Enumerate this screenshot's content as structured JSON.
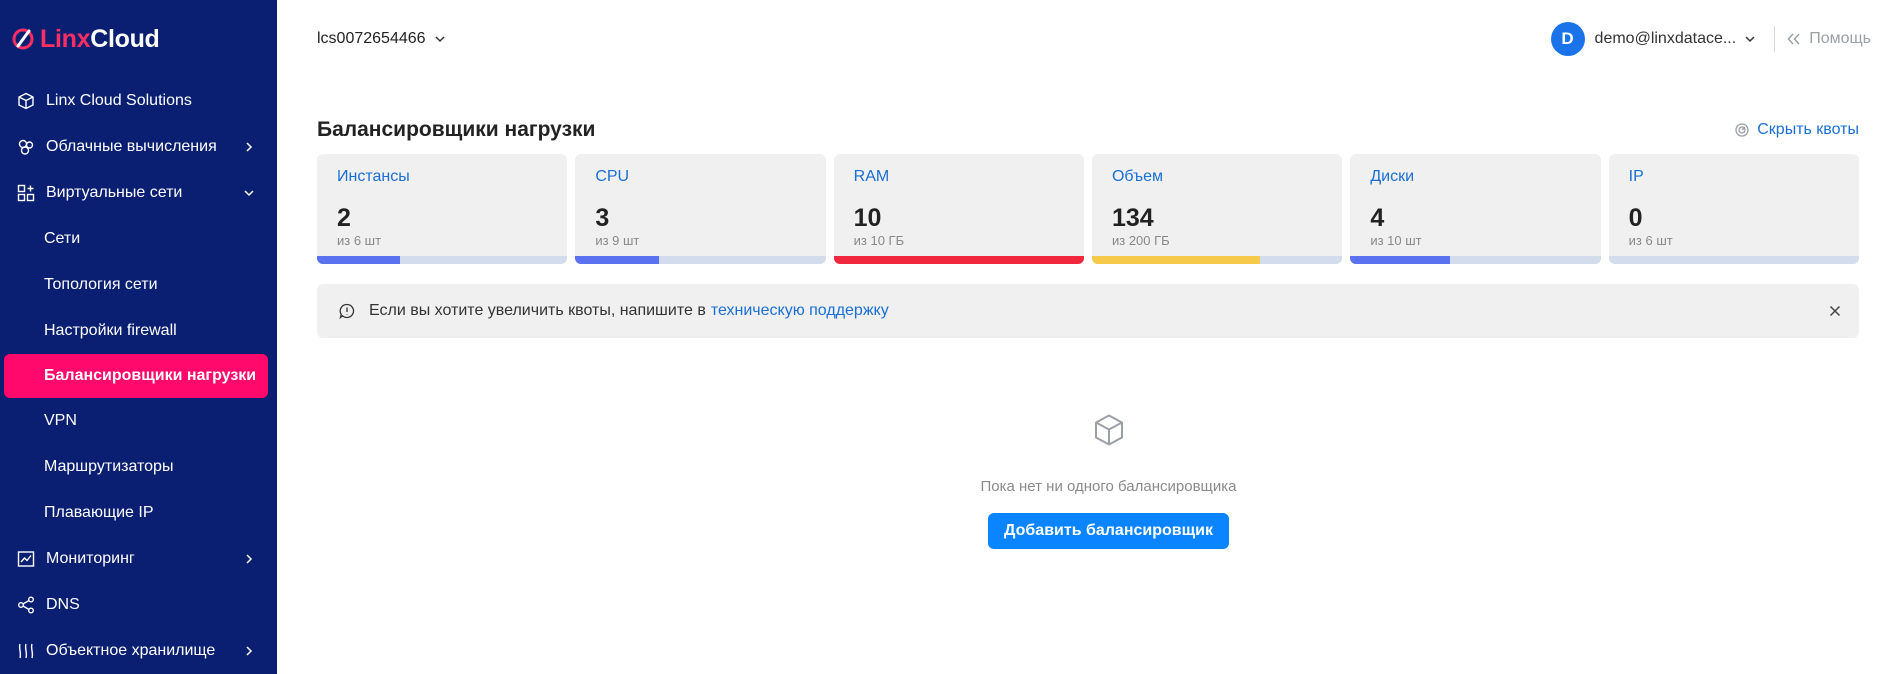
{
  "brand": {
    "part1": "Linx",
    "part2": "Cloud",
    "accent": "#ff2e63"
  },
  "sidebar": {
    "items": [
      {
        "label": "Linx Cloud Solutions",
        "icon": "cube-icon"
      },
      {
        "label": "Облачные вычисления",
        "icon": "cloud-compute-icon",
        "chevron": "right"
      },
      {
        "label": "Виртуальные сети",
        "icon": "network-icon",
        "chevron": "down"
      }
    ],
    "sub_items": [
      "Сети",
      "Топология сети",
      "Настройки firewall",
      "Балансировщики нагрузки",
      "VPN",
      "Маршрутизаторы",
      "Плавающие IP"
    ],
    "active_sub": "Балансировщики нагрузки",
    "bottom_items": [
      {
        "label": "Мониторинг",
        "icon": "chart-icon",
        "chevron": "right"
      },
      {
        "label": "DNS",
        "icon": "share-icon"
      },
      {
        "label": "Объектное хранилище",
        "icon": "storage-icon",
        "chevron": "right"
      }
    ]
  },
  "topbar": {
    "project": "lcs0072654466",
    "avatar_letter": "D",
    "user": "demo@linxdatace...",
    "help": "Помощь"
  },
  "page": {
    "title": "Балансировщики нагрузки",
    "hide_quotas": "Скрыть квоты"
  },
  "quotas": [
    {
      "title": "Инстансы",
      "value": "2",
      "sub": "из 6 шт",
      "fill": 0.333,
      "color": "#5a72f0"
    },
    {
      "title": "CPU",
      "value": "3",
      "sub": "из 9 шт",
      "fill": 0.333,
      "color": "#5a72f0"
    },
    {
      "title": "RAM",
      "value": "10",
      "sub": "из 10 ГБ",
      "fill": 1.0,
      "color": "#f0273d"
    },
    {
      "title": "Объем",
      "value": "134",
      "sub": "из 200 ГБ",
      "fill": 0.67,
      "color": "#f7c94b"
    },
    {
      "title": "Диски",
      "value": "4",
      "sub": "из 10 шт",
      "fill": 0.4,
      "color": "#5a72f0"
    },
    {
      "title": "IP",
      "value": "0",
      "sub": "из 6 шт",
      "fill": 0,
      "color": "#5a72f0"
    }
  ],
  "notice": {
    "text": "Если вы хотите увеличить квоты, напишите в",
    "link": "техническую поддержку"
  },
  "empty": {
    "text": "Пока нет ни одного балансировщика",
    "button": "Добавить балансировщик"
  }
}
